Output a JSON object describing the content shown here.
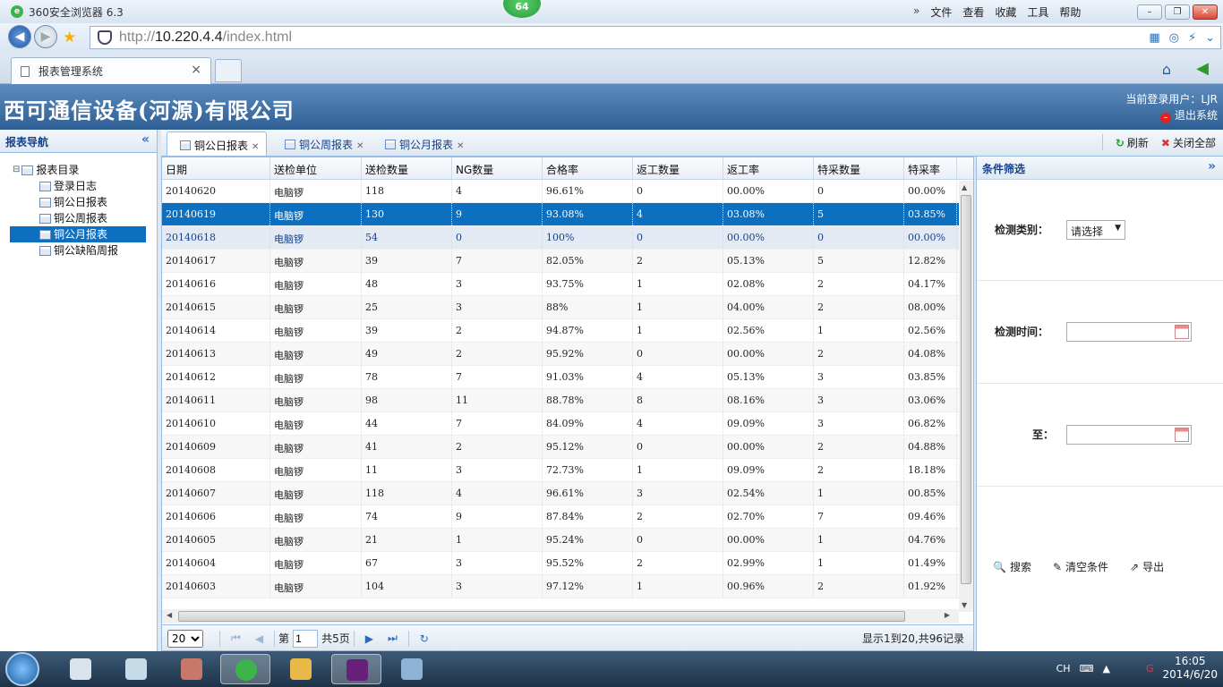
{
  "browser": {
    "title": "360安全浏览器 6.3",
    "badge": "64",
    "menus": [
      "文件",
      "查看",
      "收藏",
      "工具",
      "帮助"
    ],
    "url_prefix": "http://",
    "url_host": "10.220.4.4",
    "url_path": "/index.html",
    "tab_title": "报表管理系统",
    "tab_close": "×"
  },
  "app": {
    "company": "西可通信设备(河源)有限公司",
    "current_user": "当前登录用户：LJR",
    "logout": "退出系统"
  },
  "nav": {
    "title": "报表导航",
    "root": "报表目录",
    "items": [
      {
        "label": "登录日志",
        "selected": false
      },
      {
        "label": "铜公日报表",
        "selected": false
      },
      {
        "label": "铜公周报表",
        "selected": false
      },
      {
        "label": "铜公月报表",
        "selected": true
      },
      {
        "label": "铜公缺陷周报",
        "selected": false
      }
    ]
  },
  "tabs": [
    {
      "label": "铜公日报表",
      "active": true
    },
    {
      "label": "铜公周报表",
      "active": false
    },
    {
      "label": "铜公月报表",
      "active": false
    }
  ],
  "toolbar": {
    "refresh": "刷新",
    "close_all": "关闭全部"
  },
  "grid": {
    "columns": [
      "日期",
      "送检单位",
      "送检数量",
      "NG数量",
      "合格率",
      "返工数量",
      "返工率",
      "特采数量",
      "特采率"
    ],
    "rows": [
      [
        "20140620",
        "电脑锣",
        "118",
        "4",
        "96.61%",
        "0",
        "00.00%",
        "0",
        "00.00%"
      ],
      [
        "20140619",
        "电脑锣",
        "130",
        "9",
        "93.08%",
        "4",
        "03.08%",
        "5",
        "03.85%"
      ],
      [
        "20140618",
        "电脑锣",
        "54",
        "0",
        "100%",
        "0",
        "00.00%",
        "0",
        "00.00%"
      ],
      [
        "20140617",
        "电脑锣",
        "39",
        "7",
        "82.05%",
        "2",
        "05.13%",
        "5",
        "12.82%"
      ],
      [
        "20140616",
        "电脑锣",
        "48",
        "3",
        "93.75%",
        "1",
        "02.08%",
        "2",
        "04.17%"
      ],
      [
        "20140615",
        "电脑锣",
        "25",
        "3",
        "88%",
        "1",
        "04.00%",
        "2",
        "08.00%"
      ],
      [
        "20140614",
        "电脑锣",
        "39",
        "2",
        "94.87%",
        "1",
        "02.56%",
        "1",
        "02.56%"
      ],
      [
        "20140613",
        "电脑锣",
        "49",
        "2",
        "95.92%",
        "0",
        "00.00%",
        "2",
        "04.08%"
      ],
      [
        "20140612",
        "电脑锣",
        "78",
        "7",
        "91.03%",
        "4",
        "05.13%",
        "3",
        "03.85%"
      ],
      [
        "20140611",
        "电脑锣",
        "98",
        "11",
        "88.78%",
        "8",
        "08.16%",
        "3",
        "03.06%"
      ],
      [
        "20140610",
        "电脑锣",
        "44",
        "7",
        "84.09%",
        "4",
        "09.09%",
        "3",
        "06.82%"
      ],
      [
        "20140609",
        "电脑锣",
        "41",
        "2",
        "95.12%",
        "0",
        "00.00%",
        "2",
        "04.88%"
      ],
      [
        "20140608",
        "电脑锣",
        "11",
        "3",
        "72.73%",
        "1",
        "09.09%",
        "2",
        "18.18%"
      ],
      [
        "20140607",
        "电脑锣",
        "118",
        "4",
        "96.61%",
        "3",
        "02.54%",
        "1",
        "00.85%"
      ],
      [
        "20140606",
        "电脑锣",
        "74",
        "9",
        "87.84%",
        "2",
        "02.70%",
        "7",
        "09.46%"
      ],
      [
        "20140605",
        "电脑锣",
        "21",
        "1",
        "95.24%",
        "0",
        "00.00%",
        "1",
        "04.76%"
      ],
      [
        "20140604",
        "电脑锣",
        "67",
        "3",
        "95.52%",
        "2",
        "02.99%",
        "1",
        "01.49%"
      ],
      [
        "20140603",
        "电脑锣",
        "104",
        "3",
        "97.12%",
        "1",
        "00.96%",
        "2",
        "01.92%"
      ]
    ],
    "selected_row": 1,
    "hover_row": 2
  },
  "pager": {
    "page_size": "20",
    "page_prefix": "第",
    "page_value": "1",
    "page_suffix": "共5页",
    "info": "显示1到20,共96记录"
  },
  "filter": {
    "title": "条件筛选",
    "type_label": "检测类别：",
    "type_value": "请选择",
    "time_label": "检测时间：",
    "to_label": "至：",
    "search": "搜索",
    "clear": "清空条件",
    "export": "导出"
  },
  "taskbar": {
    "lang": "CH",
    "time": "16:05",
    "date": "2014/6/20"
  }
}
